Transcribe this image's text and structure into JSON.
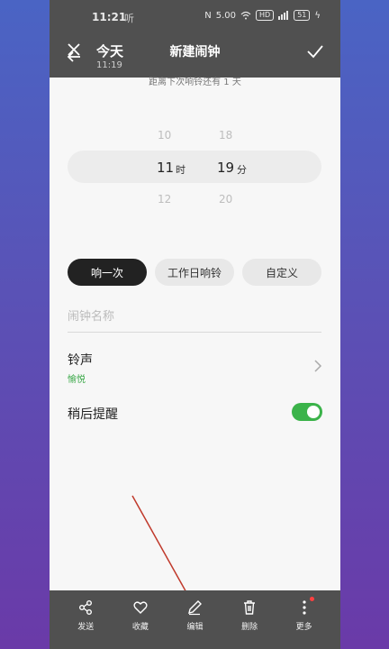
{
  "status_bar": {
    "time": "11:21",
    "carrier": "听",
    "network_speed": "5.00",
    "hd": "HD",
    "battery": "51"
  },
  "overlay": {
    "date": "今天",
    "time": "11:19"
  },
  "header": {
    "title": "新建闹钟"
  },
  "next_ring_text": "距离下次响铃还有 1 天",
  "time_picker": {
    "hour_prev": "10",
    "hour_selected": "11",
    "hour_next": "12",
    "hour_unit": "时",
    "minute_prev": "18",
    "minute_selected": "19",
    "minute_next": "20",
    "minute_unit": "分"
  },
  "repeat_options": [
    {
      "label": "响一次",
      "active": true
    },
    {
      "label": "工作日响铃",
      "active": false
    },
    {
      "label": "自定义",
      "active": false
    }
  ],
  "alarm_name": {
    "placeholder": "闹钟名称",
    "value": ""
  },
  "ringtone": {
    "label": "铃声",
    "value": "愉悦"
  },
  "snooze": {
    "label": "稍后提醒",
    "enabled": true
  },
  "bottom_bar": {
    "send": "发送",
    "favorite": "收藏",
    "edit": "编辑",
    "delete": "删除",
    "more": "更多"
  },
  "colors": {
    "accent_green": "#3bb34a",
    "overlay_gray": "#505050",
    "background": "#f7f7f7"
  }
}
